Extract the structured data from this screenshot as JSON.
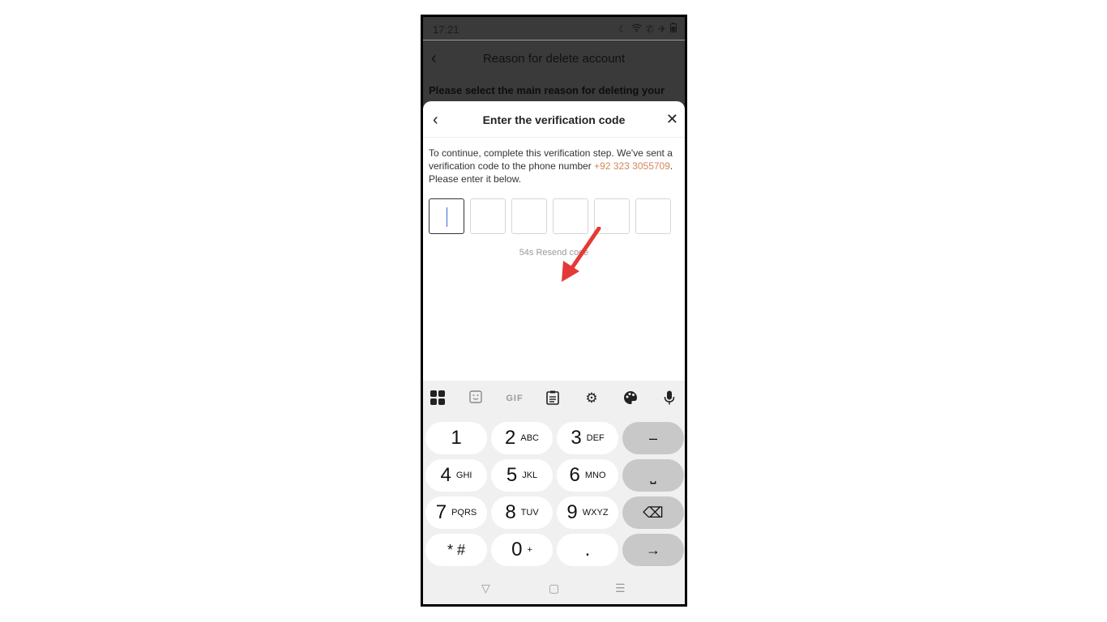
{
  "status_bar": {
    "time": "17:21",
    "icons": [
      "moon-icon",
      "wifi-icon",
      "wifi-calling-icon",
      "airplane-icon",
      "battery-icon"
    ]
  },
  "app_bar": {
    "title": "Reason for delete account"
  },
  "background_text": "Please select the main reason for deleting your",
  "sheet": {
    "title": "Enter the verification code",
    "desc_part1": "To continue, complete this verification step. We've sent a verification code to the phone number ",
    "phone": "+92 323 3055709",
    "desc_part2": ". Please enter it below.",
    "resend": "54s Resend code"
  },
  "keyboard": {
    "toolbar": [
      "apps-icon",
      "sticker-icon",
      "GIF",
      "clipboard-icon",
      "settings-icon",
      "palette-icon",
      "mic-icon"
    ],
    "gif_label": "GIF",
    "keys": {
      "k1": "1",
      "k2": "2",
      "k2s": "ABC",
      "k3": "3",
      "k3s": "DEF",
      "minus": "–",
      "k4": "4",
      "k4s": "GHI",
      "k5": "5",
      "k5s": "JKL",
      "k6": "6",
      "k6s": "MNO",
      "space": "⎵",
      "k7": "7",
      "k7s": "PQRS",
      "k8": "8",
      "k8s": "TUV",
      "k9": "9",
      "k9s": "WXYZ",
      "backspace": "⌫",
      "star": "* #",
      "k0": "0",
      "k0s": "+",
      "dot": ".",
      "enter": "→"
    }
  },
  "nav": {
    "back": "▽",
    "home": "▢",
    "recents": "☰"
  },
  "colors": {
    "accent_phone": "#d3865a",
    "cursor": "#3d6bd6",
    "annotation_arrow": "#e53935"
  }
}
